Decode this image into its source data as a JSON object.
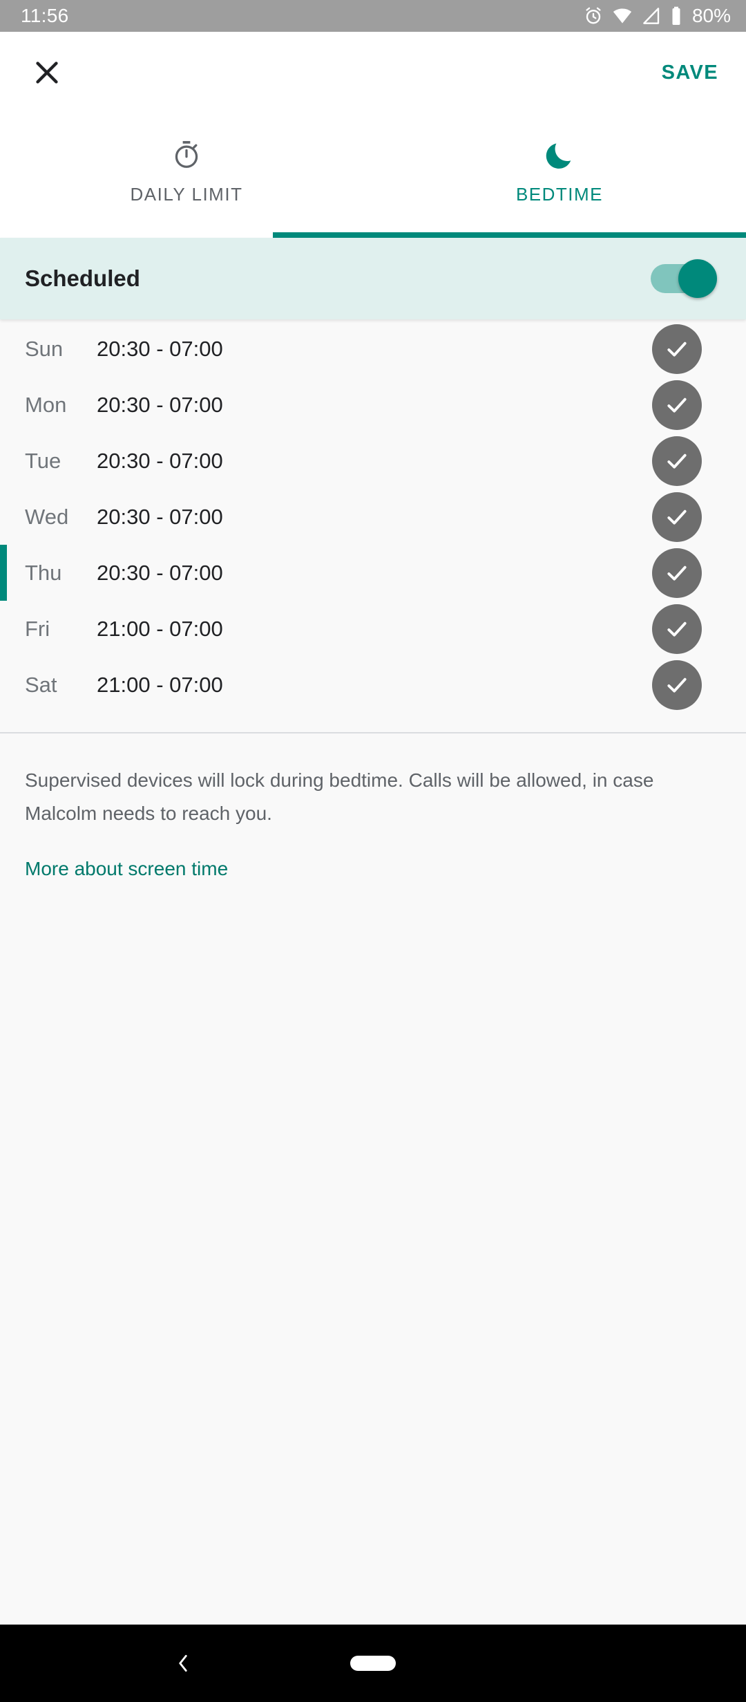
{
  "status_bar": {
    "time": "11:56",
    "battery_percent": "80%",
    "icons": [
      "alarm-icon",
      "wifi-icon",
      "signal-icon",
      "battery-icon"
    ]
  },
  "app_bar": {
    "close_label": "Close",
    "save_label": "SAVE"
  },
  "tabs": [
    {
      "label": "DAILY LIMIT",
      "icon": "timer-icon",
      "active": false
    },
    {
      "label": "BEDTIME",
      "icon": "moon-icon",
      "active": true
    }
  ],
  "scheduled": {
    "label": "Scheduled",
    "enabled": true
  },
  "schedule_rows": [
    {
      "day": "Sun",
      "time": "20:30 - 07:00",
      "checked": true,
      "focused": false
    },
    {
      "day": "Mon",
      "time": "20:30 - 07:00",
      "checked": true,
      "focused": false
    },
    {
      "day": "Tue",
      "time": "20:30 - 07:00",
      "checked": true,
      "focused": false
    },
    {
      "day": "Wed",
      "time": "20:30 - 07:00",
      "checked": true,
      "focused": false
    },
    {
      "day": "Thu",
      "time": "20:30 - 07:00",
      "checked": true,
      "focused": true
    },
    {
      "day": "Fri",
      "time": "21:00 - 07:00",
      "checked": true,
      "focused": false
    },
    {
      "day": "Sat",
      "time": "21:00 - 07:00",
      "checked": true,
      "focused": false
    }
  ],
  "footer": {
    "description": "Supervised devices will lock during bedtime. Calls will be allowed, in case Malcolm needs to reach you.",
    "link_label": "More about screen time"
  },
  "nav_bar": {
    "back_label": "Back",
    "home_label": "Home"
  },
  "colors": {
    "accent": "#00897b",
    "accent_link": "#00796b",
    "scheduled_bg": "#e0f0ee",
    "status_bar_bg": "#9e9e9e",
    "check_circle": "#6e6e6e",
    "list_bg": "#f9f9f9"
  }
}
